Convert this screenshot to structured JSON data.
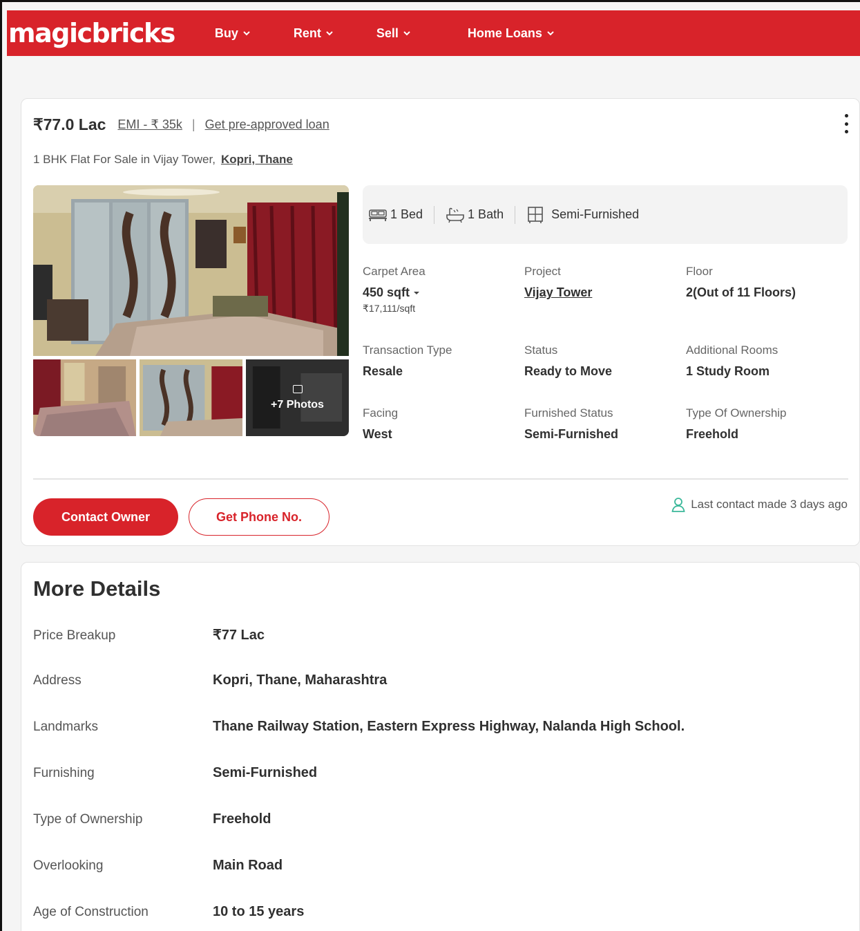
{
  "header": {
    "logo": "magicbricks",
    "nav": [
      {
        "label": "Buy"
      },
      {
        "label": "Rent"
      },
      {
        "label": "Sell"
      },
      {
        "label": "Home Loans"
      }
    ]
  },
  "listing": {
    "price": "₹77.0 Lac",
    "emi": "EMI - ₹ 35k",
    "separator": "|",
    "loan_link": "Get pre-approved loan",
    "subtitle": "1 BHK Flat For Sale in Vijay Tower,",
    "locality": "Kopri, Thane",
    "photos_more": "+7 Photos",
    "amenities": {
      "bed": "1 Bed",
      "bath": "1 Bath",
      "furnishing": "Semi-Furnished"
    },
    "specs": {
      "carpet_label": "Carpet Area",
      "carpet_value": "450 sqft",
      "carpet_rate": "₹17,111/sqft",
      "project_label": "Project",
      "project_value": "Vijay Tower",
      "floor_label": "Floor",
      "floor_value": "2(Out of 11 Floors)",
      "transaction_label": "Transaction Type",
      "transaction_value": "Resale",
      "status_label": "Status",
      "status_value": "Ready to Move",
      "rooms_label": "Additional Rooms",
      "rooms_value": "1 Study Room",
      "facing_label": "Facing",
      "facing_value": "West",
      "furnished_label": "Furnished Status",
      "furnished_value": "Semi-Furnished",
      "ownership_label": "Type Of Ownership",
      "ownership_value": "Freehold"
    },
    "contact_button": "Contact Owner",
    "phone_button": "Get Phone No.",
    "last_contact": "Last contact made 3 days ago"
  },
  "more_details": {
    "title": "More Details",
    "rows": [
      {
        "label": "Price Breakup",
        "value": "₹77 Lac"
      },
      {
        "label": "Address",
        "value": "Kopri, Thane, Maharashtra"
      },
      {
        "label": "Landmarks",
        "value": "Thane Railway Station, Eastern Express Highway, Nalanda High School."
      },
      {
        "label": "Furnishing",
        "value": "Semi-Furnished"
      },
      {
        "label": "Type of Ownership",
        "value": "Freehold"
      },
      {
        "label": "Overlooking",
        "value": "Main Road"
      },
      {
        "label": "Age of Construction",
        "value": "10 to 15 years"
      }
    ]
  },
  "colors": {
    "brand": "#d8232a",
    "contact_icon": "#3bb89a"
  }
}
